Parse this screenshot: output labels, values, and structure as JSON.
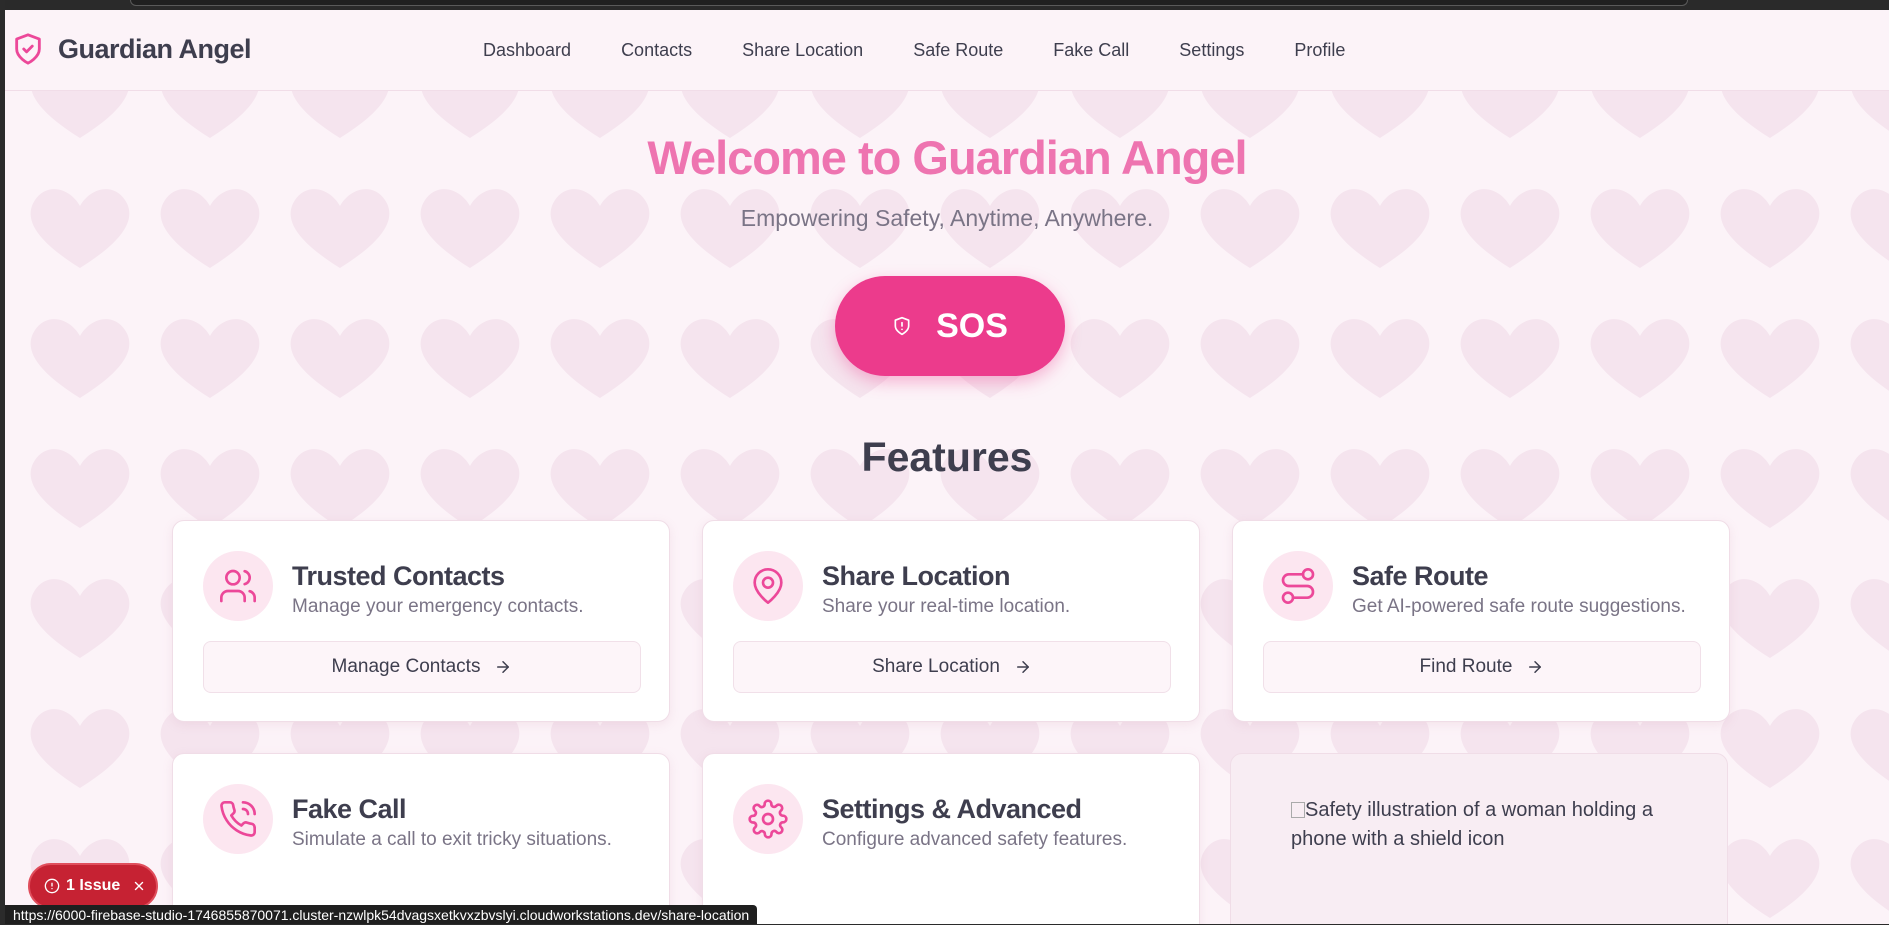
{
  "app": {
    "brand": "Guardian Angel"
  },
  "nav": [
    "Dashboard",
    "Contacts",
    "Share Location",
    "Safe Route",
    "Fake Call",
    "Settings",
    "Profile"
  ],
  "hero": {
    "title": "Welcome to Guardian Angel",
    "subtitle": "Empowering Safety, Anytime, Anywhere.",
    "sos_label": "SOS"
  },
  "features": {
    "heading": "Features",
    "cards": [
      {
        "title": "Trusted Contacts",
        "desc": "Manage your emergency contacts.",
        "button": "Manage Contacts",
        "icon": "users-icon"
      },
      {
        "title": "Share Location",
        "desc": "Share your real-time location.",
        "button": "Share Location",
        "icon": "map-pin-icon"
      },
      {
        "title": "Safe Route",
        "desc": "Get AI-powered safe route suggestions.",
        "button": "Find Route",
        "icon": "route-icon"
      },
      {
        "title": "Fake Call",
        "desc": "Simulate a call to exit tricky situations.",
        "icon": "phone-call-icon"
      },
      {
        "title": "Settings & Advanced",
        "desc": "Configure advanced safety features.",
        "icon": "gear-icon"
      }
    ],
    "image_alt": "Safety illustration of a woman holding a phone with a shield icon"
  },
  "issue_badge": "1 Issue",
  "status_url": "https://6000-firebase-studio-1746855870071.cluster-nzwlpk54dvagsxetkvxzbvslyi.cloudworkstations.dev/share-location",
  "colors": {
    "accent": "#ec3b8c",
    "title_pink": "#ee74b0",
    "icon_pink": "#ec4899",
    "issue_red": "#c62233"
  }
}
